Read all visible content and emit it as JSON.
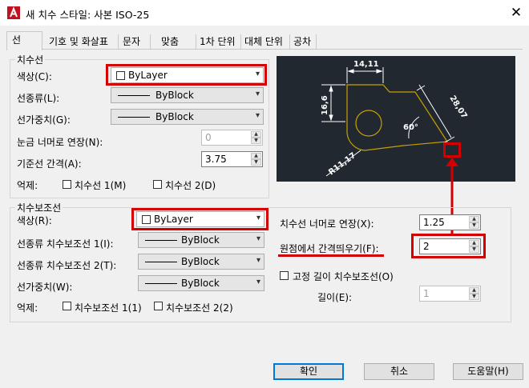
{
  "window": {
    "title": "새 치수 스타일: 사본 ISO-25",
    "close": "✕"
  },
  "tabs": [
    {
      "label": "선",
      "active": true
    },
    {
      "label": "기호 및 화살표"
    },
    {
      "label": "문자"
    },
    {
      "label": "맞춤"
    },
    {
      "label": "1차 단위"
    },
    {
      "label": "대체 단위"
    },
    {
      "label": "공차"
    }
  ],
  "dim_lines": {
    "title": "치수선",
    "color_label": "색상(C):",
    "color_value": "ByLayer",
    "linetype_label": "선종류(L):",
    "linetype_value": "ByBlock",
    "lineweight_label": "선가중치(G):",
    "lineweight_value": "ByBlock",
    "extend_ticks_label": "눈금 너머로 연장(N):",
    "extend_ticks_value": "0",
    "baseline_spacing_label": "기준선 간격(A):",
    "baseline_spacing_value": "3.75",
    "suppress_label": "억제:",
    "suppress_1": "치수선 1(M)",
    "suppress_2": "치수선 2(D)"
  },
  "ext_lines": {
    "title": "치수보조선",
    "color_label": "색상(R):",
    "color_value": "ByLayer",
    "linetype1_label": "선종류 치수보조선 1(I):",
    "linetype1_value": "ByBlock",
    "linetype2_label": "선종류 치수보조선 2(T):",
    "linetype2_value": "ByBlock",
    "lineweight_label": "선가중치(W):",
    "lineweight_value": "ByBlock",
    "suppress_label": "억제:",
    "suppress_1": "치수보조선 1(1)",
    "suppress_2": "치수보조선 2(2)",
    "extend_beyond_label": "치수선 너머로 연장(X):",
    "extend_beyond_value": "1.25",
    "offset_label": "원점에서 간격띄우기(F):",
    "offset_value": "2",
    "fixed_length_label": "고정 길이 치수보조선(O)",
    "length_label": "길이(E):",
    "length_value": "1"
  },
  "preview": {
    "dim_top": "14,11",
    "dim_left": "16,6",
    "dim_diag": "28,07",
    "angle": "60°",
    "radius": "R11,17",
    "colors": {
      "bg": "#212830",
      "geometry": "#c8a000",
      "dims": "#ffffff"
    }
  },
  "buttons": {
    "ok": "확인",
    "cancel": "취소",
    "help": "도움말(H)"
  },
  "colors": {
    "accent_red": "#d20000",
    "focus_blue": "#0078d7"
  }
}
